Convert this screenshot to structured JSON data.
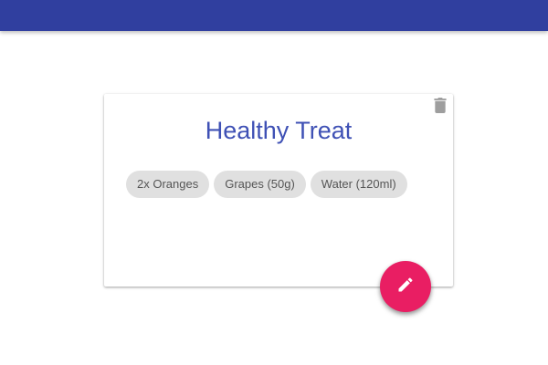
{
  "colors": {
    "appbar": "#303f9f",
    "title": "#3f51b5",
    "fab": "#e91e63",
    "delete_icon": "#9e9e9e",
    "chip_bg": "#e0e0e0"
  },
  "card": {
    "title": "Healthy Treat",
    "delete_icon": "trash-icon",
    "ingredients": [
      "2x Oranges",
      "Grapes (50g)",
      "Water (120ml)"
    ]
  },
  "fab": {
    "icon": "pencil-icon"
  }
}
